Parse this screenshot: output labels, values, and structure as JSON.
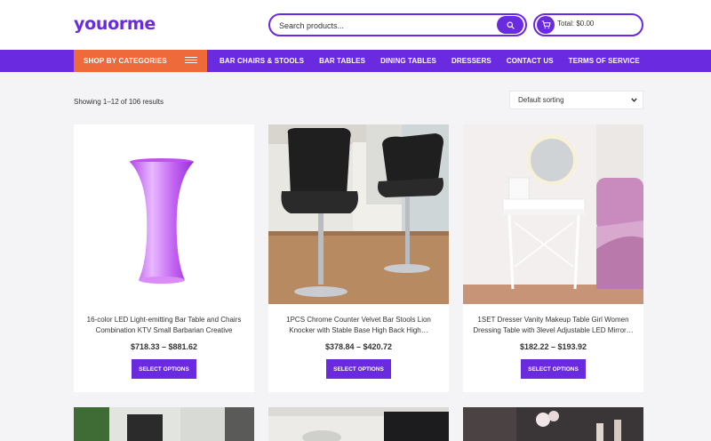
{
  "header": {
    "logo": "youorme",
    "search_placeholder": "Search products...",
    "cart_total": "Total: $0.00"
  },
  "nav": {
    "shop_by_categories": "SHOP BY CATEGORIES",
    "links": [
      "BAR CHAIRS & STOOLS",
      "BAR TABLES",
      "DINING TABLES",
      "DRESSERS",
      "CONTACT US",
      "TERMS OF SERVICE"
    ]
  },
  "toolbar": {
    "result_count": "Showing 1–12 of 106 results",
    "sorting": "Default sorting"
  },
  "products": [
    {
      "title": "16-color LED Light-emitting Bar Table and Chairs Combination KTV Small Barbarian Creative Roun…",
      "price": "$718.33 – $881.62",
      "button": "SELECT OPTIONS"
    },
    {
      "title": "1PCS Chrome Counter Velvet Bar Stools Lion Knocker with Stable Base High Back High…",
      "price": "$378.84 – $420.72",
      "button": "SELECT OPTIONS"
    },
    {
      "title": "1SET Dresser Vanity Makeup Table Girl Women Dressing Table with 3level Adjustable LED Mirror…",
      "price": "$182.22 – $193.92",
      "button": "SELECT OPTIONS"
    }
  ],
  "colors": {
    "brand": "#6a2ae0",
    "accent": "#ef6a3a"
  }
}
